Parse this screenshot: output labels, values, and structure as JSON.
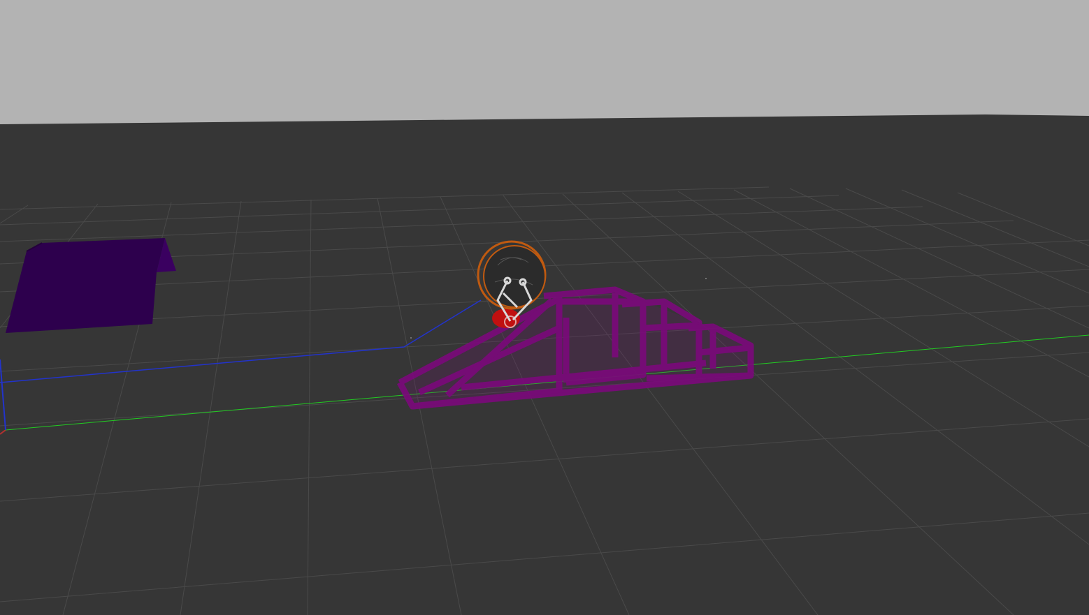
{
  "viewport": {
    "sky_color": "#b3b3b3",
    "ground_color": "#363636",
    "grid_color": "#4a4a4a",
    "axis_colors": {
      "x": "#b33030",
      "y": "#22cc22",
      "z": "#2233cc"
    }
  },
  "objects": {
    "ramp_block": {
      "color": "#2d004d"
    },
    "step_frame": {
      "color": "#7a0a7a"
    },
    "robot": {
      "body_color": "#2b2b2b",
      "ring_color": "#c05a10",
      "arm_color": "#d8d8d8",
      "base_color": "#c01010"
    },
    "path_trail": {
      "color": "#2233cc"
    }
  }
}
